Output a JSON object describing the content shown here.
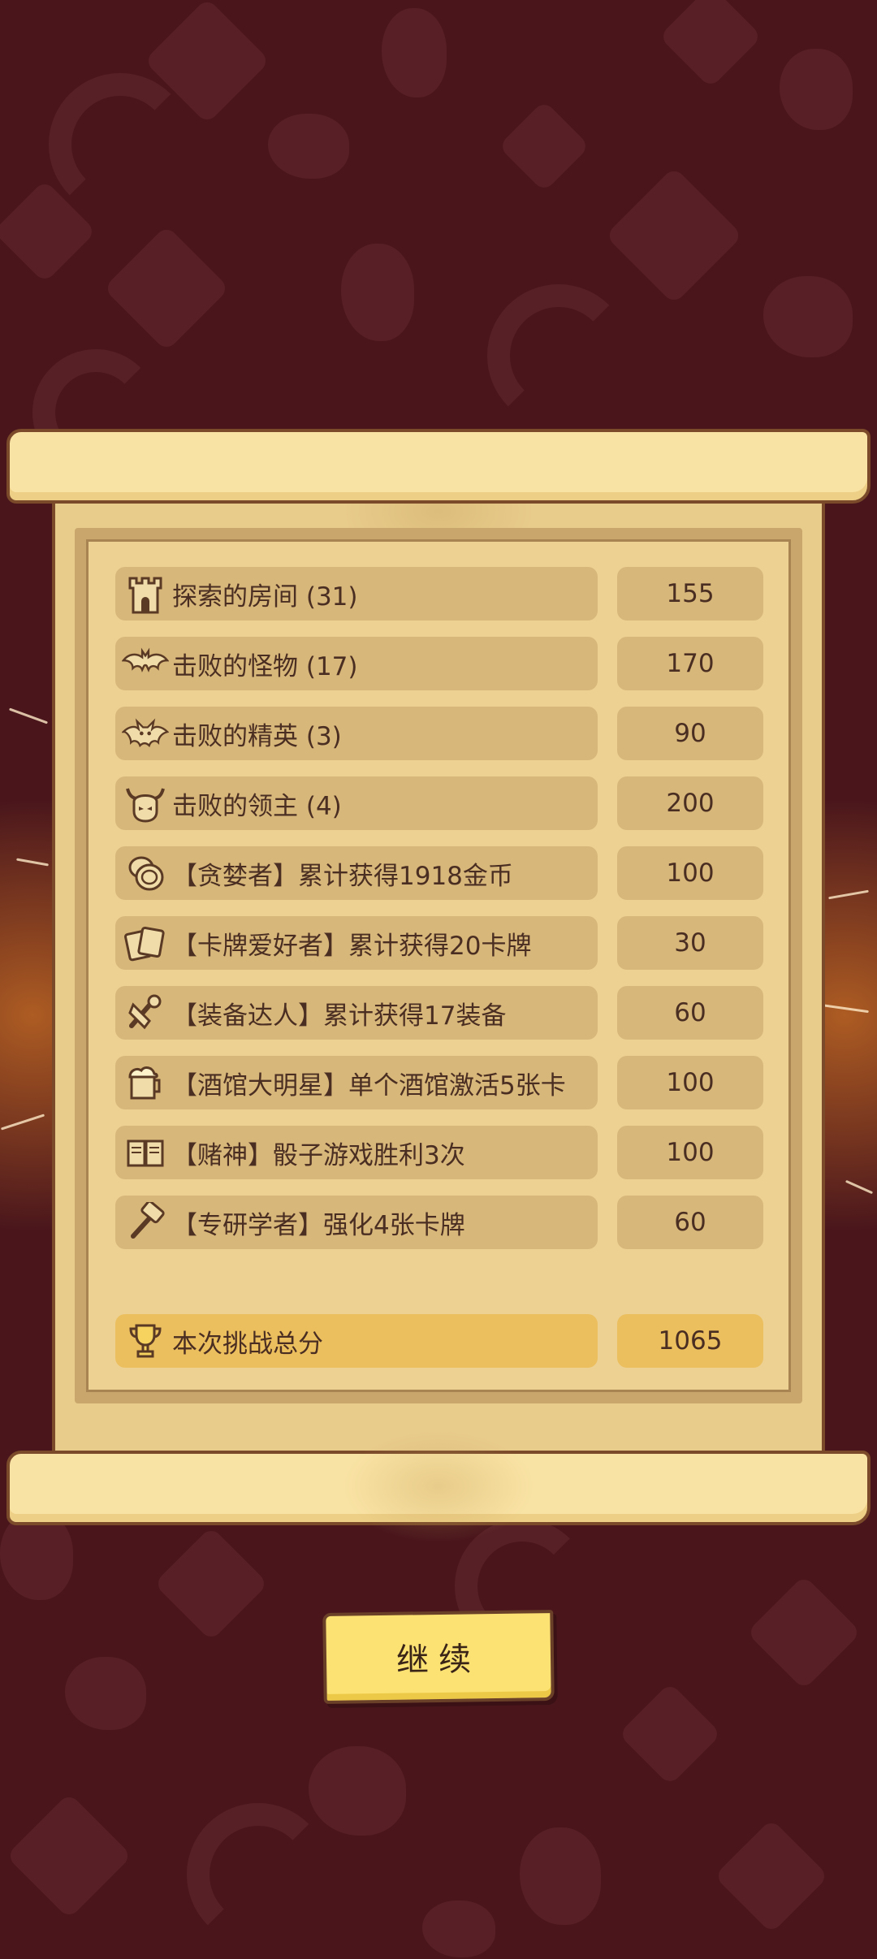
{
  "rows": [
    {
      "label": "探索的房间 (31)",
      "value": "155",
      "icon": "tower-icon"
    },
    {
      "label": "击败的怪物 (17)",
      "value": "170",
      "icon": "bat-icon"
    },
    {
      "label": "击败的精英 (3)",
      "value": "90",
      "icon": "demon-bat-icon"
    },
    {
      "label": "击败的领主 (4)",
      "value": "200",
      "icon": "horned-skull-icon"
    },
    {
      "label": "【贪婪者】累计获得1918金币",
      "value": "100",
      "icon": "coins-icon"
    },
    {
      "label": "【卡牌爱好者】累计获得20卡牌",
      "value": "30",
      "icon": "cards-icon"
    },
    {
      "label": "【装备达人】累计获得17装备",
      "value": "60",
      "icon": "equipment-icon"
    },
    {
      "label": "【酒馆大明星】单个酒馆激活5张卡",
      "value": "100",
      "icon": "beer-mug-icon"
    },
    {
      "label": "【赌神】骰子游戏胜利3次",
      "value": "100",
      "icon": "book-icon"
    },
    {
      "label": "【专研学者】强化4张卡牌",
      "value": "60",
      "icon": "hammer-icon"
    }
  ],
  "total": {
    "label": "本次挑战总分",
    "value": "1065",
    "icon": "trophy-icon"
  },
  "continue_label": "继续",
  "colors": {
    "background": "#4a161c",
    "row": "#d8b77a",
    "total_row": "#ecbf5e",
    "button": "#fbe272"
  }
}
